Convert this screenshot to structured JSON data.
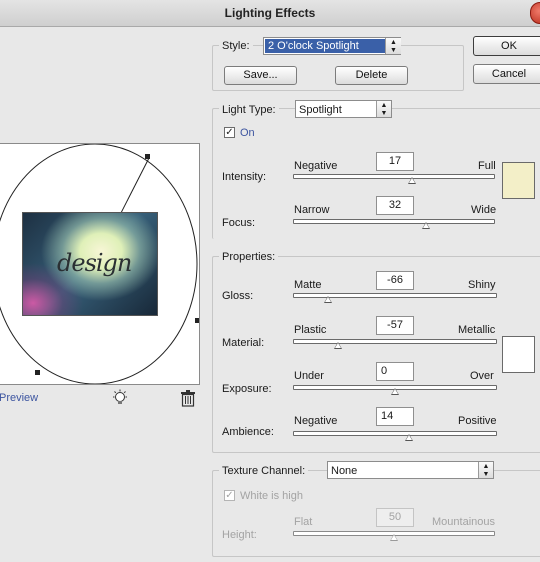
{
  "window": {
    "title": "Lighting Effects"
  },
  "style": {
    "label": "Style:",
    "value": "2 O'clock Spotlight",
    "save_label": "Save...",
    "delete_label": "Delete"
  },
  "actions": {
    "ok_label": "OK",
    "cancel_label": "Cancel"
  },
  "light_type": {
    "label": "Light Type:",
    "value": "Spotlight",
    "on_label": "On",
    "on_checked": true
  },
  "intensity": {
    "label": "Intensity:",
    "min_label": "Negative",
    "max_label": "Full",
    "value": "17",
    "level": 0.59
  },
  "focus": {
    "label": "Focus:",
    "min_label": "Narrow",
    "max_label": "Wide",
    "value": "32",
    "level": 0.66
  },
  "light_color": "#f3efc8",
  "properties": {
    "label": "Properties:",
    "gloss": {
      "label": "Gloss:",
      "min_label": "Matte",
      "max_label": "Shiny",
      "value": "-66",
      "level": 0.17
    },
    "material": {
      "label": "Material:",
      "min_label": "Plastic",
      "max_label": "Metallic",
      "value": "-57",
      "level": 0.22
    },
    "exposure": {
      "label": "Exposure:",
      "min_label": "Under",
      "max_label": "Over",
      "value": "0",
      "level": 0.5
    },
    "ambience": {
      "label": "Ambience:",
      "min_label": "Negative",
      "max_label": "Positive",
      "value": "14",
      "level": 0.57
    },
    "ambient_color": "#ffffff"
  },
  "texture": {
    "label": "Texture Channel:",
    "value": "None",
    "white_is_high_label": "White is high",
    "white_is_high_checked": true,
    "height": {
      "label": "Height:",
      "min_label": "Flat",
      "max_label": "Mountainous",
      "value": "50",
      "level": 0.5
    }
  },
  "preview": {
    "label": "Preview",
    "image_text": "design",
    "bulb_icon": "lightbulb-icon",
    "trash_icon": "trash-icon"
  }
}
